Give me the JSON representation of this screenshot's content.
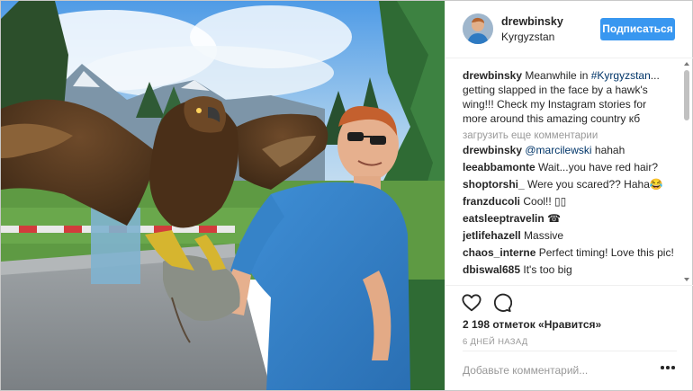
{
  "post": {
    "username": "drewbinsky",
    "location": "Kyrgyzstan",
    "follow_label": "Подписаться",
    "caption": {
      "username": "drewbinsky",
      "text_before": " Meanwhile in ",
      "hashtag": "#Kyrgyzstan",
      "text_after": "... getting slapped in the face by a hawk's wing!!! Check my Instagram stories for more around this amazing country кб"
    },
    "load_more_label": "загрузить еще комментарии",
    "comments": [
      {
        "username": "drewbinsky",
        "mention": "@marcilewski",
        "text": " hahah"
      },
      {
        "username": "leeabbamonte",
        "text": "Wait...you have red hair?"
      },
      {
        "username": "shoptorshi_",
        "text": "Were you scared?? Haha😂"
      },
      {
        "username": "franzducoli",
        "text": "Cool!! ▯▯"
      },
      {
        "username": "eatsleeptravelin",
        "text": "☎"
      },
      {
        "username": "jetlifehazell",
        "text": "Massive"
      },
      {
        "username": "chaos_interne",
        "text": "Perfect timing! Love this pic!"
      },
      {
        "username": "dbiswal685",
        "text": "It's too big"
      }
    ],
    "likes_label": "2 198 отметок «Нравится»",
    "time_ago": "6 ДНЕЙ НАЗАД",
    "add_comment_placeholder": "Добавьте комментарий..."
  },
  "icons": {
    "like": "heart-icon",
    "comment": "comment-bubble-icon",
    "more": "more-options-icon"
  },
  "colors": {
    "accent": "#3897f0",
    "link": "#003569",
    "muted": "#999999",
    "text": "#262626"
  }
}
